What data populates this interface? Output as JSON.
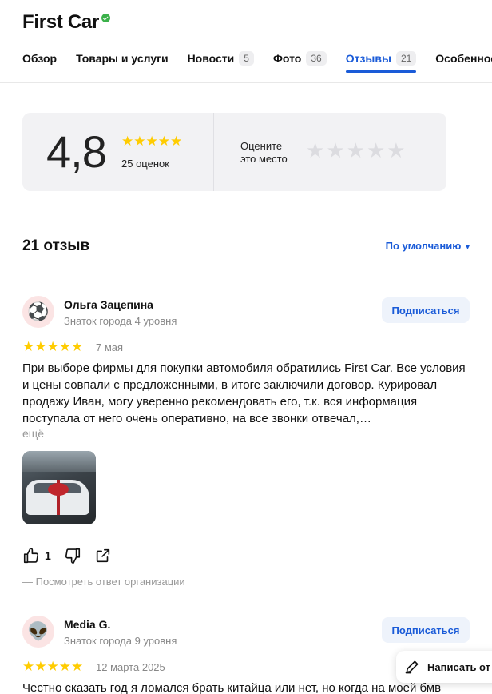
{
  "org": {
    "title": "First Car",
    "verified_icon": "verified-check-icon"
  },
  "tabs": [
    {
      "label": "Обзор",
      "count": null,
      "active": false
    },
    {
      "label": "Товары и услуги",
      "count": null,
      "active": false
    },
    {
      "label": "Новости",
      "count": "5",
      "active": false
    },
    {
      "label": "Фото",
      "count": "36",
      "active": false
    },
    {
      "label": "Отзывы",
      "count": "21",
      "active": true
    },
    {
      "label": "Особенности",
      "count": null,
      "active": false
    }
  ],
  "rating": {
    "value": "4,8",
    "stars": "★★★★★",
    "count_label": "25 оценок",
    "rate_prompt_line1": "Оцените",
    "rate_prompt_line2": "это место",
    "rate_stars": 5
  },
  "reviews_header": {
    "count_label": "21 отзыв",
    "sort_label": "По умолчанию",
    "sort_arrow": "▾"
  },
  "reviews": [
    {
      "avatar": "⚽",
      "avatar_icon": "soccer-ball-icon",
      "name": "Ольга Зацепина",
      "level": "Знаток города 4 уровня",
      "subscribe": "Подписаться",
      "stars": "★★★★★",
      "date": "7 мая",
      "text": "При выборе фирмы для покупки автомобиля обратились First Car. Все условия и цены совпали с предложенными, в итоге заключили договор. Курировал продажу Иван, могу уверенно рекомендовать его, т.к. вся информация поступала от него очень оперативно, на все звонки отвечал,…",
      "more": "ещё",
      "likes": "1",
      "org_reply": "— Посмотреть ответ организации"
    },
    {
      "avatar": "👽",
      "avatar_icon": "alien-icon",
      "name": "Media G.",
      "level": "Знаток города 9 уровня",
      "subscribe": "Подписаться",
      "stars": "★★★★★",
      "date": "12 марта 2025",
      "text": "Честно сказать год я ломался брать китайца или нет, но когда на моей бмв"
    }
  ],
  "write_review": {
    "label": "Написать от"
  },
  "colors": {
    "accent": "#1a5bd8",
    "star": "#ffcc00",
    "verified": "#3bb14a"
  }
}
